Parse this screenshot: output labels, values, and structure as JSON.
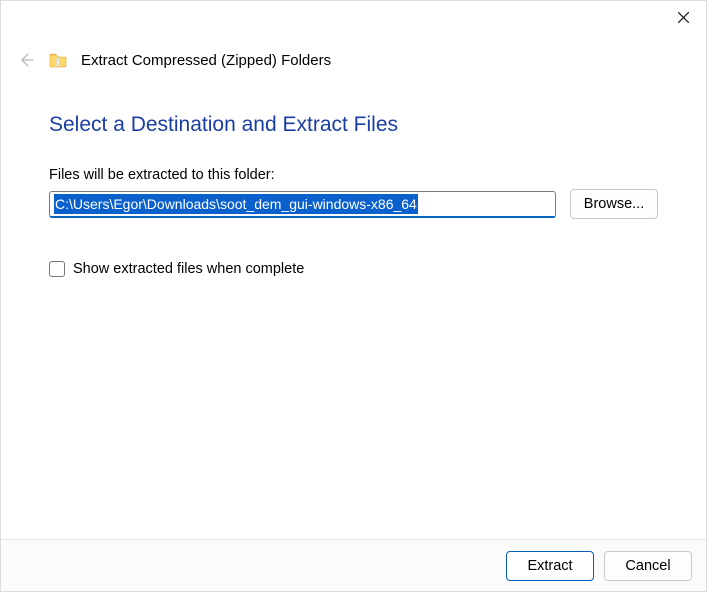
{
  "window": {
    "wizard_title": "Extract Compressed (Zipped) Folders"
  },
  "body": {
    "heading": "Select a Destination and Extract Files",
    "path_label": "Files will be extracted to this folder:",
    "path_value": "C:\\Users\\Egor\\Downloads\\soot_dem_gui-windows-x86_64",
    "browse_label": "Browse...",
    "show_files_label": "Show extracted files when complete",
    "show_files_checked": false
  },
  "footer": {
    "extract_label": "Extract",
    "cancel_label": "Cancel"
  },
  "icons": {
    "close": "close-icon",
    "back": "back-arrow-icon",
    "folder": "zipped-folder-icon"
  }
}
